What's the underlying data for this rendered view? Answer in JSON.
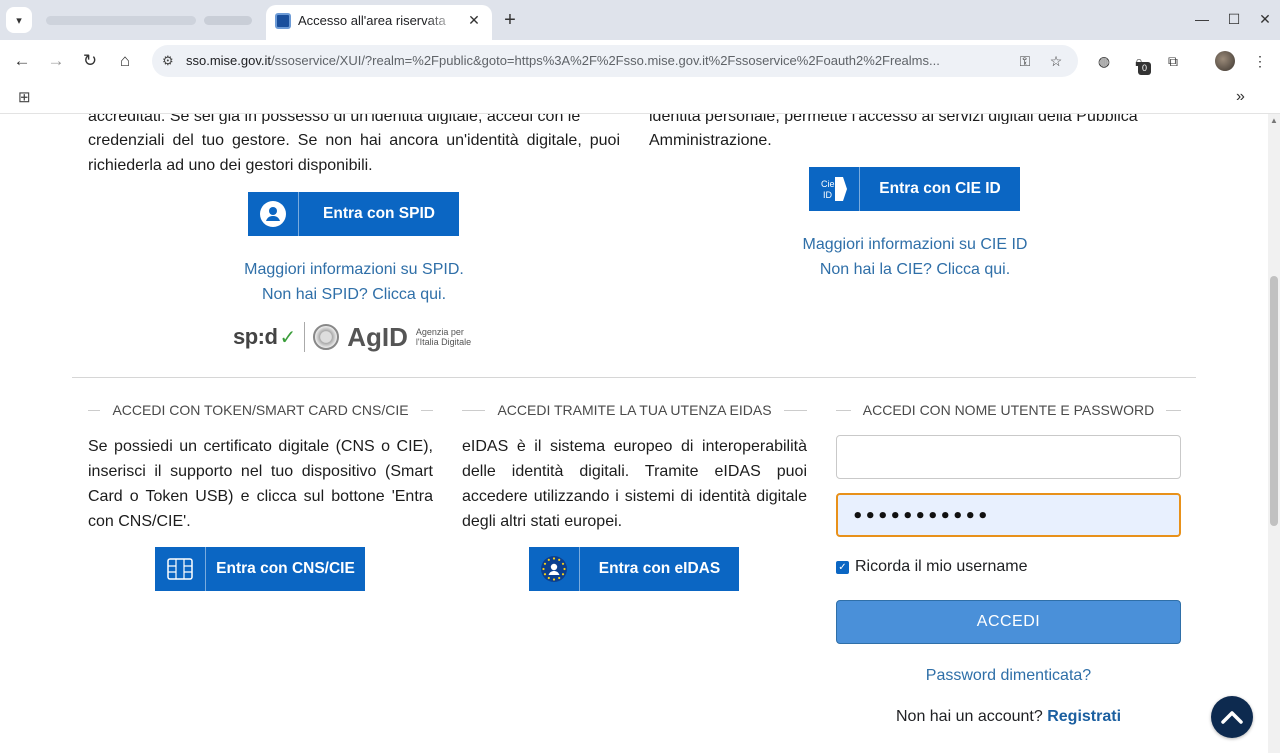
{
  "browser": {
    "active_tab_title": "Accesso all'area riservata",
    "new_tab_label": "+",
    "url_host": "sso.mise.gov.it",
    "url_path": "/ssoservice/XUI/?realm=%2Fpublic&goto=https%3A%2F%2Fsso.mise.gov.it%2Fssoservice%2Foauth2%2Frealms...",
    "extension_badge": "0"
  },
  "spid": {
    "intro_top": "accreditati. Se sei già in possesso di un'identità digitale, accedi con le",
    "intro": "credenziali del tuo gestore. Se non hai ancora un'identità digitale, puoi richiederla ad uno dei gestori disponibili.",
    "button_label": "Entra con SPID",
    "info_link": "Maggiori informazioni su SPID.",
    "no_spid_link": "Non hai SPID? Clicca qui.",
    "logo_spid": "sp:d",
    "logo_agid": "AgID",
    "logo_agid_sub1": "Agenzia per",
    "logo_agid_sub2": "l'Italia Digitale"
  },
  "cie": {
    "intro_top": "identità personale, permette l'accesso ai servizi digitali della Pubblica",
    "intro": "Amministrazione.",
    "button_label": "Entra con CIE ID",
    "icon_text": "Cie ID",
    "info_link": "Maggiori informazioni su CIE ID",
    "no_cie_link": "Non hai la CIE? Clicca qui."
  },
  "cns": {
    "title": "ACCEDI CON TOKEN/SMART CARD CNS/CIE",
    "text": "Se possiedi un certificato digitale (CNS o CIE), inserisci il supporto nel tuo dispositivo (Smart Card o Token USB) e clicca sul bottone 'Entra con CNS/CIE'.",
    "button_label": "Entra con CNS/CIE"
  },
  "eidas": {
    "title": "ACCEDI TRAMITE LA TUA UTENZA EIDAS",
    "text": "eIDAS è il sistema europeo di interoperabilità delle identità digitali. Tramite eIDAS puoi accedere utilizzando i sistemi di identità digitale degli altri stati europei.",
    "button_label": "Entra con eIDAS"
  },
  "login": {
    "title": "ACCEDI CON NOME UTENTE E PASSWORD",
    "username_value": "",
    "password_mask": "•••••••••••",
    "remember_label": "Ricorda il mio username",
    "remember_checked": true,
    "submit_label": "ACCEDI",
    "forgot_link": "Password dimenticata?",
    "no_account_text": "Non hai un account?",
    "register_link": "Registrati"
  },
  "colors": {
    "primary_blue": "#0b66c3",
    "link_blue": "#2f6fa8",
    "focus_orange": "#e8911a",
    "back_to_top": "#0d2a4f"
  }
}
